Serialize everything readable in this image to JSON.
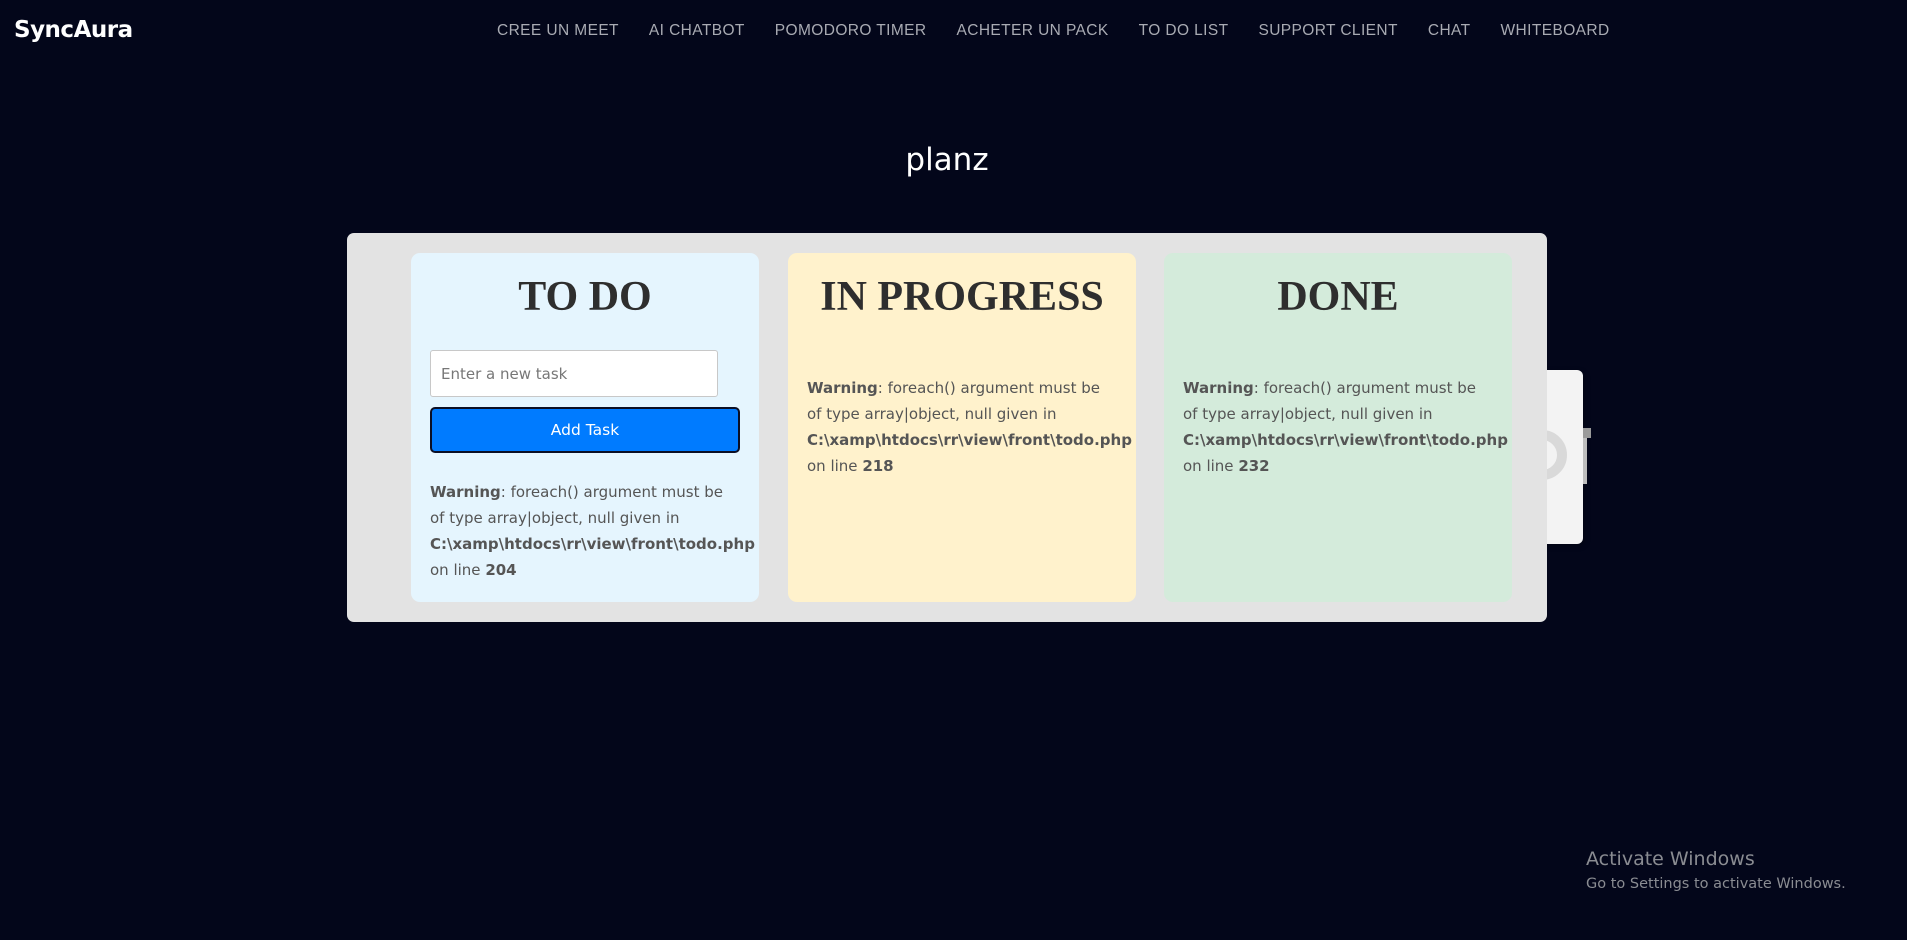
{
  "brand": "SyncAura",
  "nav": [
    "CREE UN MEET",
    "AI CHATBOT",
    "POMODORO TIMER",
    "ACHETER UN PACK",
    "TO DO LIST",
    "SUPPORT CLIENT",
    "CHAT",
    "WHITEBOARD"
  ],
  "page_title": "planz",
  "columns": {
    "todo": {
      "title": "TO DO",
      "input_placeholder": "Enter a new task",
      "input_value": "",
      "button_label": "Add Task",
      "warning": {
        "label": "Warning",
        "message": ": foreach() argument must be of type array|object, null given in",
        "file": "C:\\xamp\\htdocs\\rr\\view\\front\\todo.php",
        "line_text": "on line",
        "line": "204"
      }
    },
    "progress": {
      "title": "IN PROGRESS",
      "warning": {
        "label": "Warning",
        "message": ": foreach() argument must be of type array|object, null given in",
        "file": "C:\\xamp\\htdocs\\rr\\view\\front\\todo.php",
        "line_text": "on line",
        "line": "218"
      }
    },
    "done": {
      "title": "DONE",
      "warning": {
        "label": "Warning",
        "message": ": foreach() argument must be of type array|object, null given in",
        "file": "C:\\xamp\\htdocs\\rr\\view\\front\\todo.php",
        "line_text": "on line",
        "line": "232"
      }
    }
  },
  "watermark": {
    "line1": "Activate Windows",
    "line2": "Go to Settings to activate Windows."
  },
  "colors": {
    "background": "#03061a",
    "board": "#e3e3e3",
    "todo_column": "#e5f5fe",
    "progress_column": "#fff2cc",
    "done_column": "#d4ebdb",
    "accent_button": "#007bff"
  }
}
